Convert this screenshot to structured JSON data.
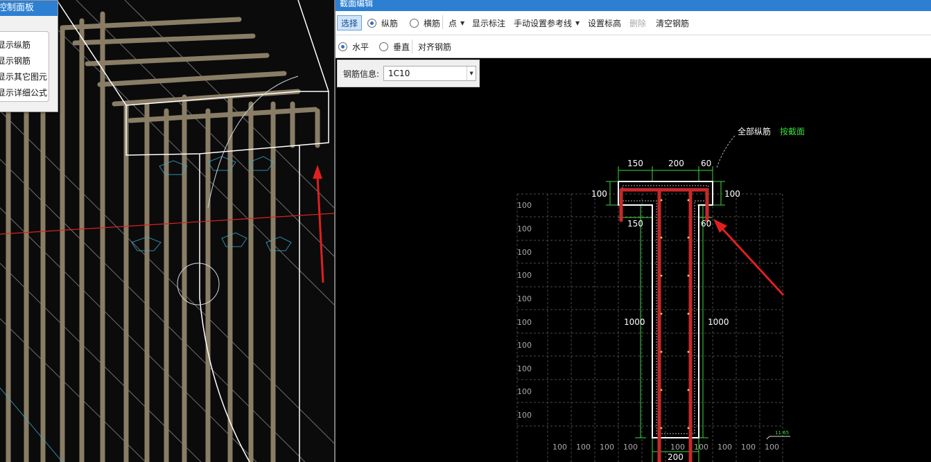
{
  "control_panel": {
    "title": "控制面板",
    "items": [
      "显示纵筋",
      "显示钢筋",
      "显示其它图元",
      "显示详细公式"
    ]
  },
  "editor": {
    "title": "截面编辑",
    "toolbar1": {
      "select": "选择",
      "longitudinal": "纵筋",
      "stirrup": "横筋",
      "point": "点",
      "show_label": "显示标注",
      "manual_ref": "手动设置参考线",
      "set_elevation": "设置标高",
      "delete": "删除",
      "clear_rebar": "清空钢筋"
    },
    "toolbar2": {
      "horizontal": "水平",
      "vertical": "垂直",
      "align_rebar": "对齐钢筋"
    },
    "rebar_info": {
      "label": "钢筋信息:",
      "value": "1C10"
    },
    "drawing": {
      "annotation_main": "全部纵筋",
      "annotation_link": "按截面",
      "dim_top": [
        "150",
        "200",
        "60"
      ],
      "dim_left": "100",
      "dim_right": "100",
      "dim_inner_left": "150",
      "dim_inner_right": "60",
      "dim_height_left": "1000",
      "dim_height_right": "1000",
      "dim_bottom": "200",
      "grid_left": [
        "100",
        "100",
        "100",
        "100",
        "100",
        "100",
        "100",
        "100",
        "100",
        "100"
      ],
      "grid_bottom": [
        "100",
        "100",
        "100",
        "100",
        "100",
        "100",
        "100",
        "100",
        "100",
        "100"
      ],
      "elevation_tag": "11.65"
    },
    "colors": {
      "rebar": "#c8282b",
      "dimension": "#3cdc3c",
      "annotation_link": "#3cdc3c",
      "arrow": "#e02020"
    }
  }
}
